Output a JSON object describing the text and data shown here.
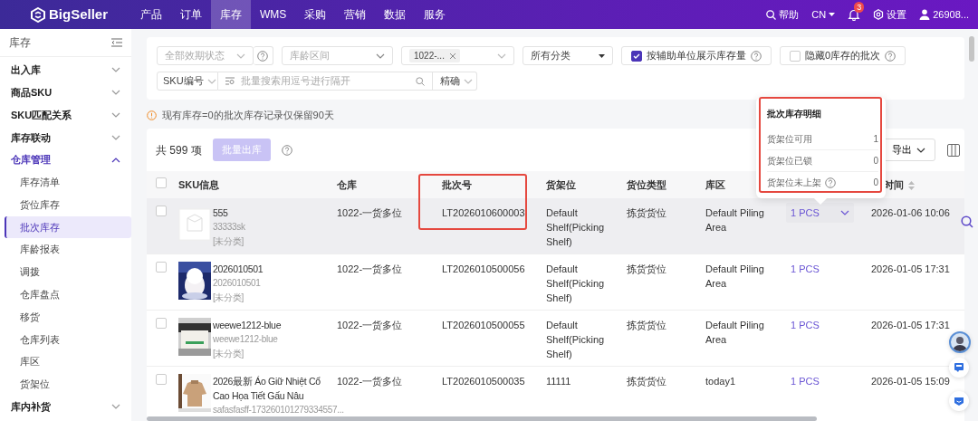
{
  "nav": {
    "logo": "BigSeller",
    "items": [
      {
        "label": "产品",
        "selected": false
      },
      {
        "label": "订单",
        "selected": false
      },
      {
        "label": "库存",
        "selected": true
      },
      {
        "label": "WMS",
        "selected": false
      },
      {
        "label": "采购",
        "selected": false
      },
      {
        "label": "营销",
        "selected": false
      },
      {
        "label": "数据",
        "selected": false
      },
      {
        "label": "服务",
        "selected": false
      }
    ],
    "help": "帮助",
    "language": "CN",
    "notifications": "3",
    "settings": "设置",
    "user": "26908..."
  },
  "sidebar": {
    "title": "库存",
    "groups": [
      {
        "label": "出入库",
        "expanded": false,
        "selected": false
      },
      {
        "label": "商品SKU",
        "expanded": false,
        "selected": false
      },
      {
        "label": "SKU匹配关系",
        "expanded": false,
        "selected": false
      },
      {
        "label": "库存联动",
        "expanded": false,
        "selected": false
      },
      {
        "label": "仓库管理",
        "expanded": true,
        "selected": true,
        "children": [
          {
            "label": "库存清单",
            "selected": false
          },
          {
            "label": "货位库存",
            "selected": false
          },
          {
            "label": "批次库存",
            "selected": true
          },
          {
            "label": "库龄报表",
            "selected": false
          },
          {
            "label": "调拨",
            "selected": false
          },
          {
            "label": "仓库盘点",
            "selected": false
          },
          {
            "label": "移货",
            "selected": false
          },
          {
            "label": "仓库列表",
            "selected": false
          },
          {
            "label": "库区",
            "selected": false
          },
          {
            "label": "货架位",
            "selected": false
          }
        ]
      },
      {
        "label": "库内补货",
        "expanded": false,
        "selected": false
      }
    ]
  },
  "filters": {
    "expiry": {
      "placeholder": "全部效期状态"
    },
    "age": {
      "placeholder": "库龄区间"
    },
    "warehouse_tag": "1022-...",
    "category": "所有分类",
    "aux_unit": {
      "label": "按辅助单位展示库存量",
      "checked": true
    },
    "hide_zero": {
      "label": "隐藏0库存的批次",
      "checked": false
    },
    "search_type": "SKU编号",
    "search": {
      "placeholder": "批量搜索用逗号进行隔开"
    },
    "match": "精确"
  },
  "notice": "现有库存=0的批次库存记录仅保留90天",
  "toolbar": {
    "total": "共 599 项",
    "bulk_out": {
      "label": "批量出库",
      "disabled": true
    },
    "export": "导出"
  },
  "table": {
    "all_selected": false,
    "columns": [
      {
        "kind": "sku",
        "label": "SKU信息"
      },
      {
        "kind": "text",
        "label": "仓库"
      },
      {
        "kind": "text",
        "label": "批次号",
        "highlighted": true
      },
      {
        "kind": "text",
        "label": "货架位"
      },
      {
        "kind": "text",
        "label": "货位类型"
      },
      {
        "kind": "text",
        "label": "库区"
      },
      {
        "kind": "quantity"
      },
      {
        "kind": "time",
        "label": "时间",
        "sortable": true
      }
    ],
    "rows": [
      {
        "selected": false,
        "hovered": true,
        "kind": "no-image",
        "title": "555",
        "code": "33333sk",
        "category": "[未分类]",
        "warehouse": "1022-一货多位",
        "batch": "LT2026010600003",
        "shelf": "Default Shelf(Picking Shelf)",
        "shelf_type": "拣货货位",
        "area": "Default Piling Area",
        "quantity": "1 PCS",
        "expanded": true,
        "time": "2026-01-06 10:06"
      },
      {
        "selected": false,
        "hovered": false,
        "title": "2026010501",
        "code": "2026010501",
        "category": "[未分类]",
        "warehouse": "1022-一货多位",
        "batch": "LT2026010500056",
        "shelf": "Default Shelf(Picking Shelf)",
        "shelf_type": "拣货货位",
        "area": "Default Piling Area",
        "quantity": "1 PCS",
        "expanded": false,
        "time": "2026-01-05 17:31"
      },
      {
        "selected": false,
        "hovered": false,
        "title": "weewe1212-blue",
        "code": "weewe1212-blue",
        "category": "[未分类]",
        "warehouse": "1022-一货多位",
        "batch": "LT2026010500055",
        "shelf": "Default Shelf(Picking Shelf)",
        "shelf_type": "拣货货位",
        "area": "Default Piling Area",
        "quantity": "1 PCS",
        "expanded": false,
        "time": "2026-01-05 17:31"
      },
      {
        "selected": false,
        "hovered": false,
        "title": "2026最新 Áo Giữ Nhiệt Cổ Cao Họa Tiết Gấu Nâu",
        "code": "safasfasff-173260101279334557...",
        "warehouse": "1022-一货多位",
        "batch": "LT2026010500035",
        "shelf": "11111",
        "shelf_type": "拣货货位",
        "area": "today1",
        "quantity": "1 PCS",
        "expanded": false,
        "time": "2026-01-05 15:09"
      }
    ]
  },
  "popover": {
    "title": "批次库存明细",
    "highlighted": true,
    "rows": [
      {
        "label": "货架位可用",
        "value": "1",
        "help": false
      },
      {
        "label": "货架位已锁",
        "value": "0",
        "help": false
      },
      {
        "label": "货架位未上架",
        "value": "0",
        "help": true
      }
    ]
  }
}
